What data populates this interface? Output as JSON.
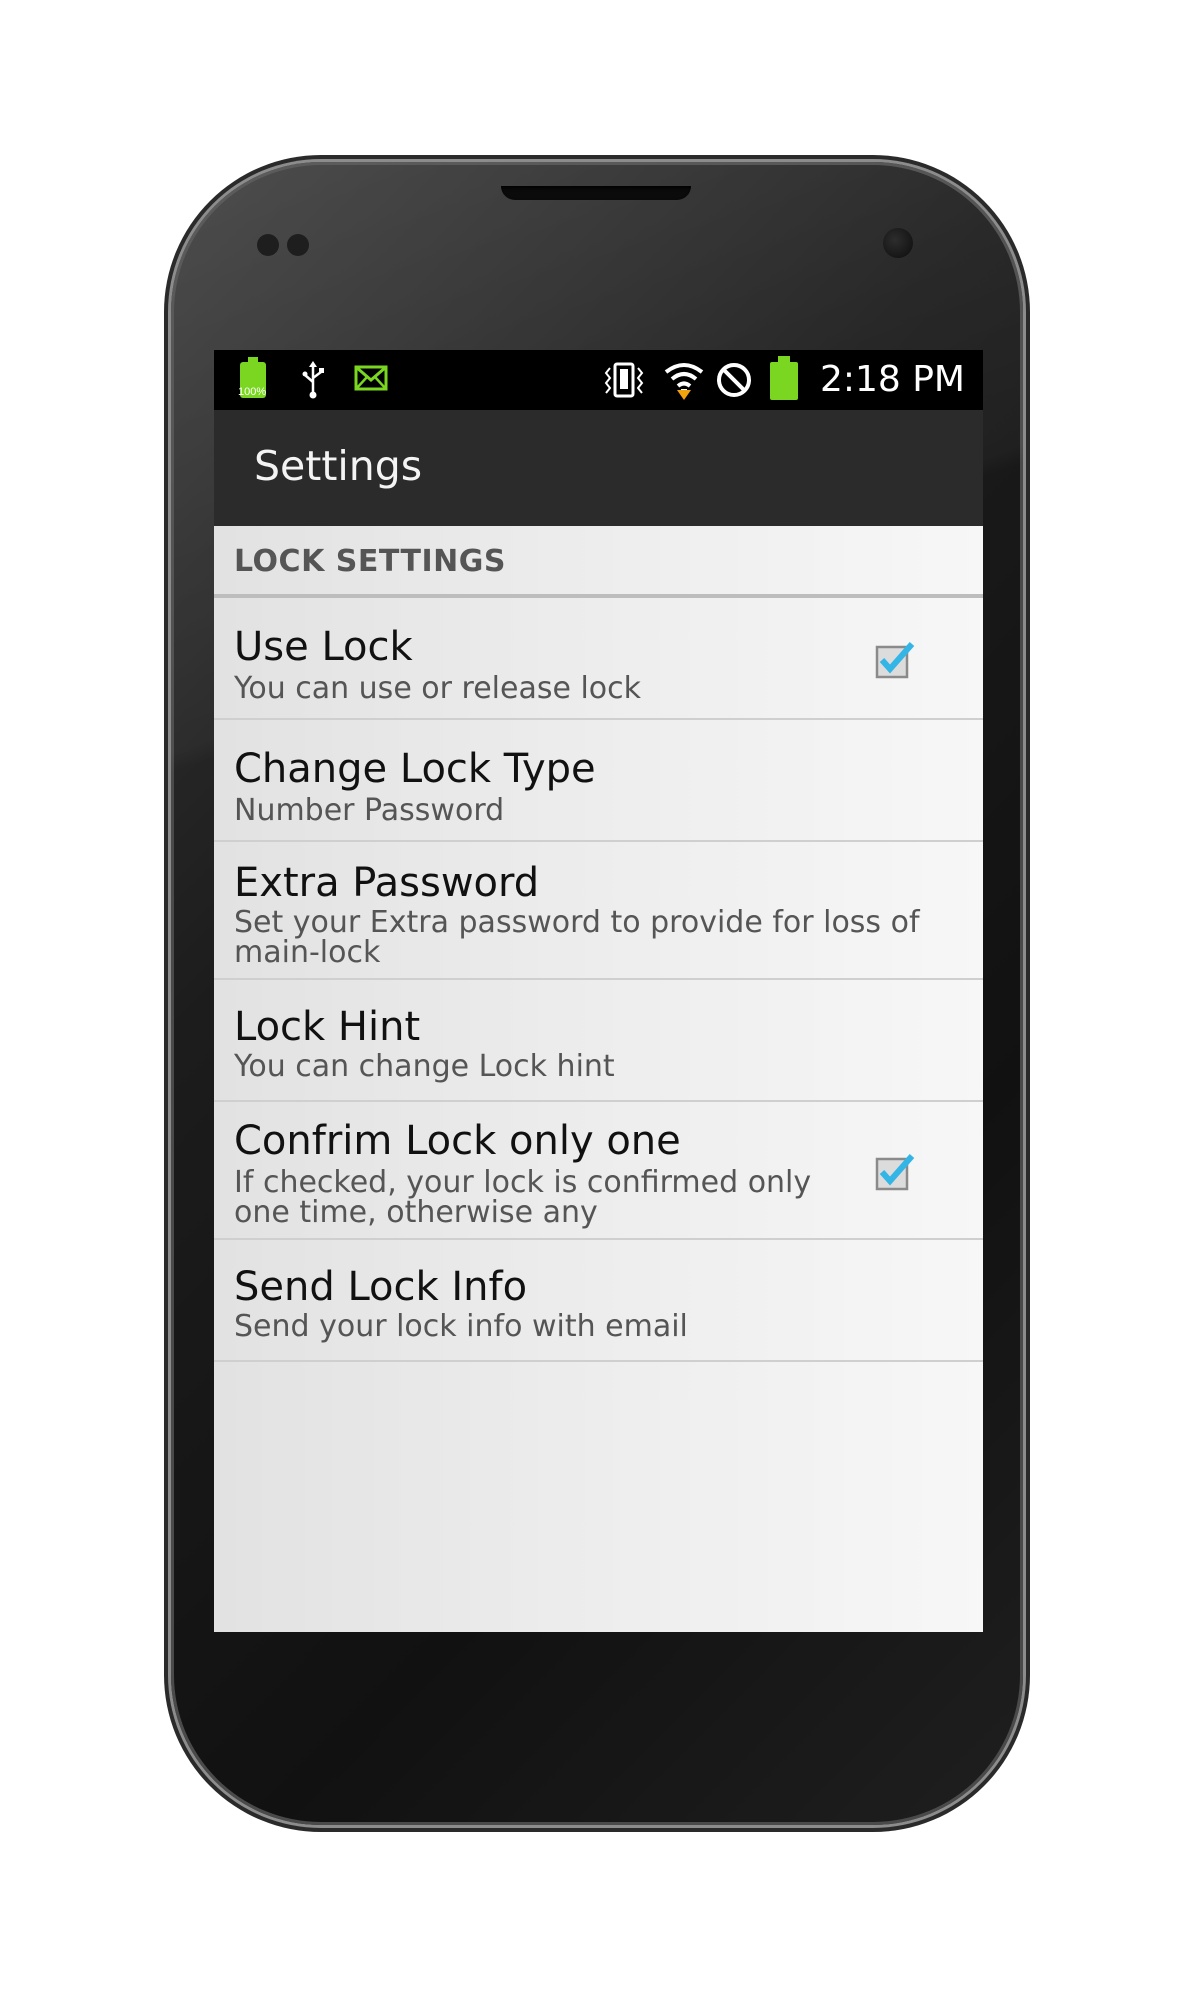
{
  "status_bar": {
    "battery_percent_label": "100%",
    "time": "2:18 PM",
    "icons": [
      "battery-icon",
      "usb-icon",
      "mail-icon",
      "vibrate-icon",
      "wifi-icon",
      "no-sim-icon",
      "battery-full-icon"
    ]
  },
  "action_bar": {
    "title": "Settings"
  },
  "section": {
    "title": "LOCK SETTINGS"
  },
  "prefs": [
    {
      "title": "Use Lock",
      "summary": "You can use or release lock",
      "checkbox": true,
      "checked": true
    },
    {
      "title": "Change Lock Type",
      "summary": "Number Password",
      "checkbox": false
    },
    {
      "title": "Extra Password",
      "summary": "Set your Extra password to provide for loss of main-lock",
      "summary_lines": [
        "Set your Extra password to provide for loss of",
        "main-lock"
      ],
      "checkbox": false
    },
    {
      "title": "Lock Hint",
      "summary": "You can change Lock hint",
      "checkbox": false
    },
    {
      "title": "Confrim Lock only one",
      "summary": "If checked, your lock is confirmed only one time, otherwise any",
      "summary_lines": [
        "If checked, your lock is confirmed only",
        "one time, otherwise any"
      ],
      "checkbox": true,
      "checked": true
    },
    {
      "title": "Send Lock Info",
      "summary": "Send your lock info with email",
      "checkbox": false
    }
  ],
  "colors": {
    "accent_check": "#33b5e5",
    "battery_green": "#7ad620",
    "action_bar": "#2b2b2b"
  }
}
